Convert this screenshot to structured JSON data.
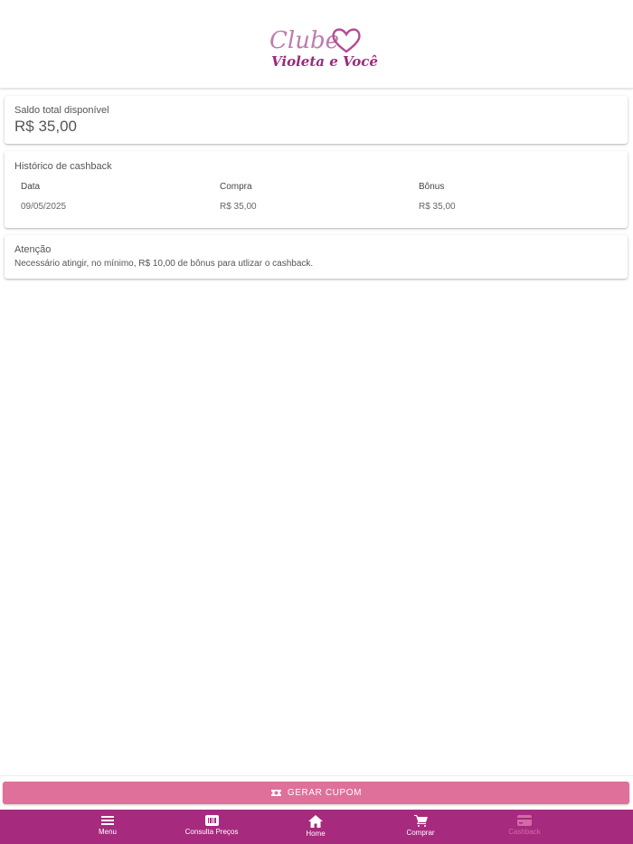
{
  "logo": {
    "line1": "Clube",
    "line2": "Violeta e Você"
  },
  "saldo": {
    "label": "Saldo total disponível",
    "value": "R$ 35,00"
  },
  "historico": {
    "title": "Histórico de cashback",
    "columns": [
      "Data",
      "Compra",
      "Bônus"
    ],
    "rows": [
      [
        "09/05/2025",
        "R$ 35,00",
        "R$ 35,00"
      ]
    ]
  },
  "atencao": {
    "title": "Atenção",
    "text": "Necessário atingir, no mínimo, R$ 10,00 de bônus para utlizar o cashback."
  },
  "cupom_button": {
    "label": "GERAR CUPOM",
    "icon": "ticket-icon"
  },
  "nav": [
    {
      "label": "Menu",
      "icon": "menu-icon"
    },
    {
      "label": "Consulta Preços",
      "icon": "barcode-icon"
    },
    {
      "label": "Home",
      "icon": "home-icon"
    },
    {
      "label": "Comprar",
      "icon": "cart-icon"
    },
    {
      "label": "Cashback",
      "icon": "card-icon",
      "active": true
    }
  ],
  "colors": {
    "brand": "#a62a7e",
    "button": "#df7099",
    "active_nav": "#d46aa7"
  }
}
